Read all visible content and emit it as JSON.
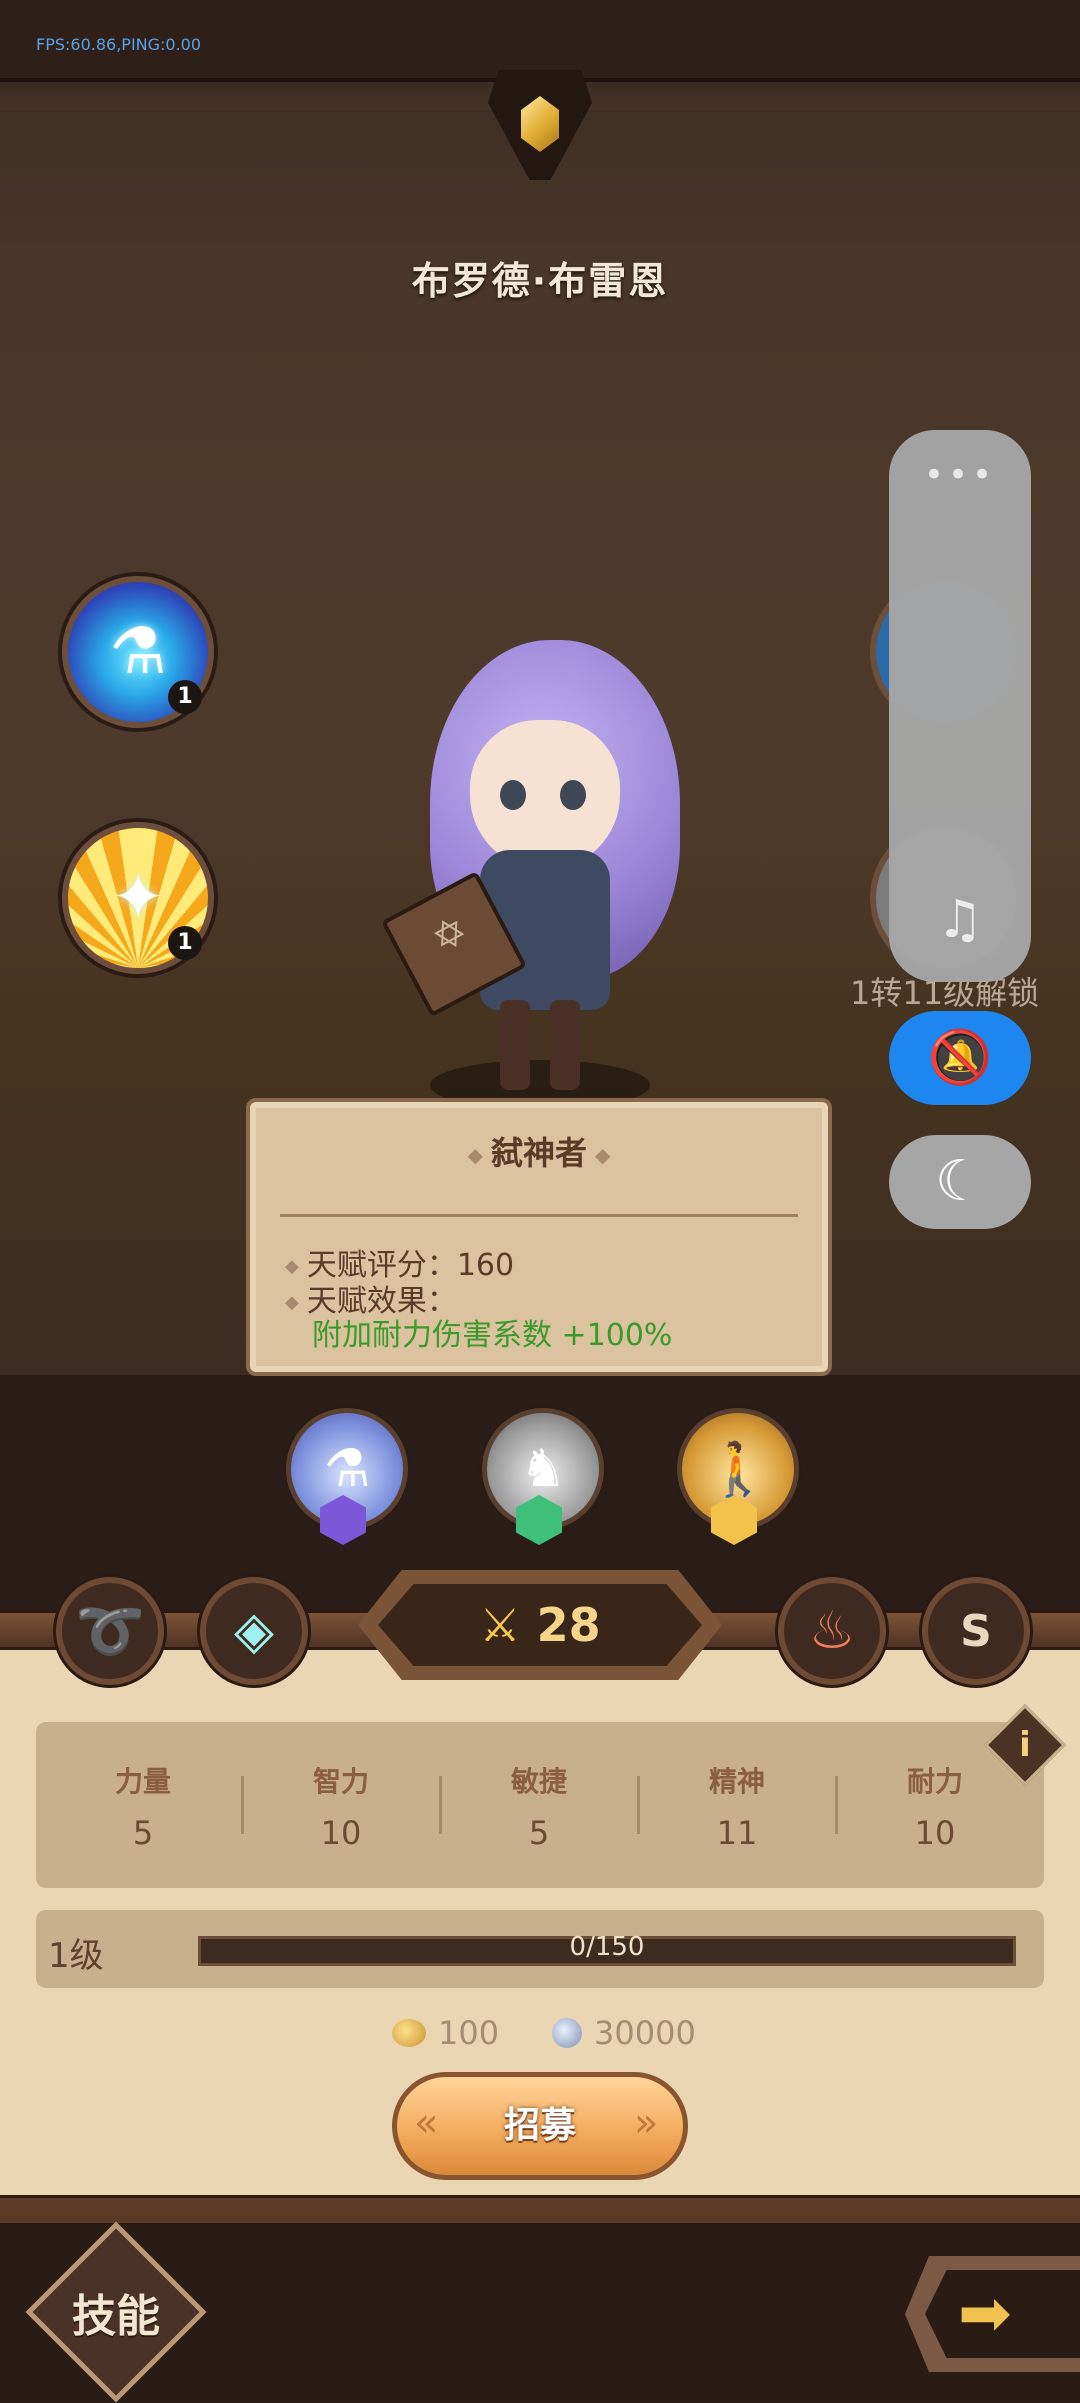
{
  "hud": {
    "fps_text": "FPS:60.86,PING:0.00"
  },
  "hero": {
    "name": "布罗德·布雷恩"
  },
  "skills": {
    "potion": {
      "level": "1",
      "icon": "potion-icon"
    },
    "golden": {
      "level": "1",
      "icon": "sparkle-icon"
    },
    "locked_hint": "1转11级解锁"
  },
  "talent_popup": {
    "title": "弑神者",
    "score_line": "天赋评分：160",
    "effect_label": "天赋效果：",
    "effect_text": "附加耐力伤害系数 +100%",
    "effect_color": "#3c9a2a"
  },
  "talent_buttons": [
    {
      "name": "potion-talent",
      "gem_color": "#7a58d8"
    },
    {
      "name": "statue-talent",
      "gem_color": "#3ec07a"
    },
    {
      "name": "body-talent",
      "gem_color": "#f2c24a"
    }
  ],
  "combat": {
    "power": "28",
    "s_label": "S"
  },
  "stats": [
    {
      "label": "力量",
      "value": "5"
    },
    {
      "label": "智力",
      "value": "10"
    },
    {
      "label": "敏捷",
      "value": "5"
    },
    {
      "label": "精神",
      "value": "11"
    },
    {
      "label": "耐力",
      "value": "10"
    }
  ],
  "level": {
    "label": "1级",
    "xp_text": "0/150",
    "xp_fraction": 0
  },
  "costs": {
    "gold": "100",
    "silver": "30000"
  },
  "recruit": {
    "label": "招募"
  },
  "nav": {
    "skills_label": "技能"
  },
  "side_panel": {
    "dots": "•••"
  },
  "colors": {
    "accent_blue": "#1e86f0",
    "panel_bg": "#ebd6b3"
  }
}
